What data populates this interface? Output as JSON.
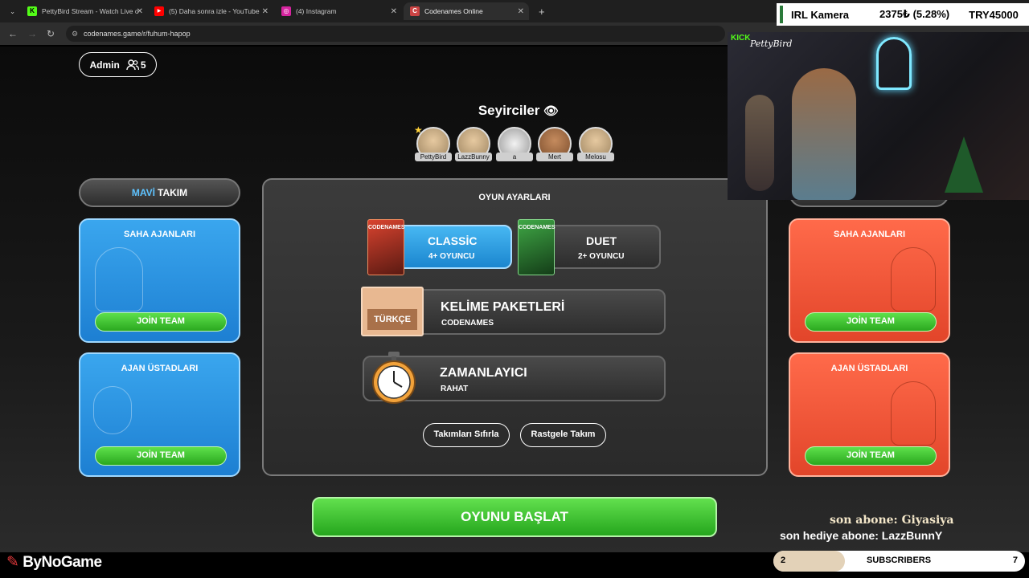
{
  "browser": {
    "tabs": [
      {
        "title": "PettyBird Stream - Watch Live o",
        "icon": "K"
      },
      {
        "title": "(5) Daha sonra izle - YouTube",
        "icon": "▶"
      },
      {
        "title": "(4) Instagram",
        "icon": "◎"
      },
      {
        "title": "Codenames Online",
        "icon": "C"
      }
    ],
    "url": "codenames.game/r/fuhum-hapop"
  },
  "overlay": {
    "irl_label": "IRL Kamera",
    "irl_value": "2375₺ (5.28%)",
    "irl_goal": "TRY45000",
    "kick_label": "KICK",
    "kick_name": "PettyBird",
    "last_sub": "son abone: Giyasiya",
    "last_gift": "son hediye abone: LazzBunnY",
    "subs_label": "SUBSCRIBERS",
    "subs_current": "2",
    "subs_goal": "7",
    "subs_progress": 0.2857,
    "logo": "ByNoGame"
  },
  "game": {
    "admin_label": "Admin",
    "player_count": "5",
    "spectators_title": "Seyirciler",
    "spectators": [
      "PettyBird",
      "LazzBunny",
      "a",
      "Mert",
      "Melosu"
    ],
    "blue_team": {
      "prefix": "MAVİ",
      "suffix": "TAKIM"
    },
    "operatives_label": "SAHA AJANLARI",
    "spymasters_label": "AJAN ÜSTADLARI",
    "join_label": "JOİN TEAM",
    "settings_title": "OYUN AYARLARI",
    "modes": [
      {
        "name": "CLASSİC",
        "players": "4+ OYUNCU",
        "box": "CODENAMES"
      },
      {
        "name": "DUET",
        "players": "2+ OYUNCU",
        "box": "CODENAMES"
      }
    ],
    "word_packs": {
      "title": "KELİME PAKETLERİ",
      "value": "CODENAMES",
      "badge": "TÜRKÇE"
    },
    "timer": {
      "title": "ZAMANLAYICI",
      "value": "RAHAT"
    },
    "reset_teams": "Takımları Sıfırla",
    "random_teams": "Rastgele Takım",
    "start_game": "OYUNU BAŞLAT"
  },
  "colors": {
    "blue": "#1d7fd2",
    "red": "#e2452a",
    "green": "#2aa81f"
  }
}
